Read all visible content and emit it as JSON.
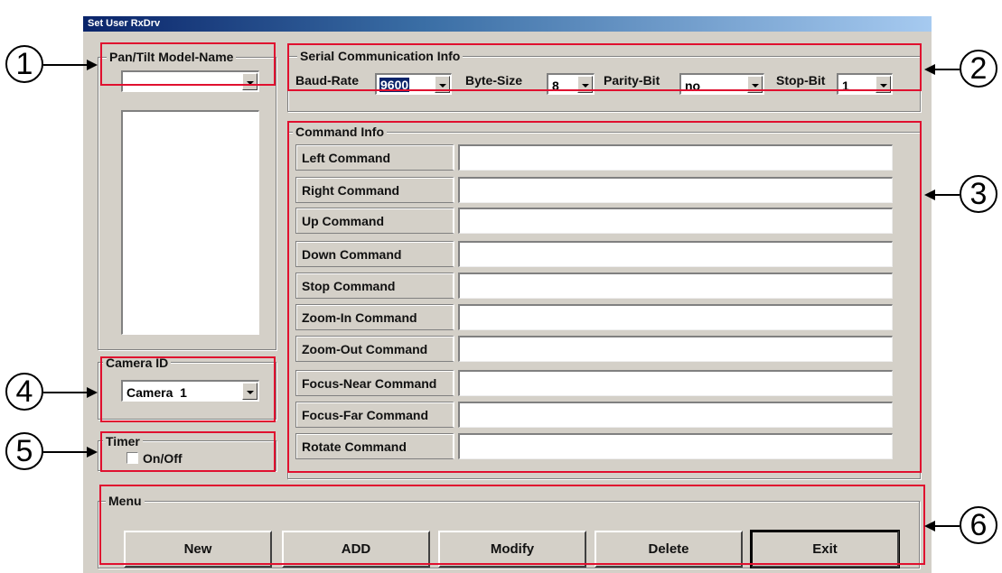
{
  "window": {
    "title": "Set User RxDrv"
  },
  "model_group": {
    "legend": "Pan/Tilt Model-Name",
    "selected": ""
  },
  "serial_group": {
    "legend": "Serial Communication Info",
    "baud_label": "Baud-Rate",
    "baud_value": "9600",
    "byte_label": "Byte-Size",
    "byte_value": "8",
    "parity_label": "Parity-Bit",
    "parity_value": "no",
    "stop_label": "Stop-Bit",
    "stop_value": "1"
  },
  "command_group": {
    "legend": "Command Info",
    "commands": [
      "Left Command",
      "Right Command",
      "Up Command",
      "Down Command",
      "Stop Command",
      "Zoom-In Command",
      "Zoom-Out Command",
      "Focus-Near Command",
      "Focus-Far Command",
      "Rotate Command"
    ]
  },
  "camera_group": {
    "legend": "Camera ID",
    "selected": "Camera  1"
  },
  "timer_group": {
    "legend": "Timer",
    "checkbox_label": "On/Off",
    "checked": false
  },
  "menu_group": {
    "legend": "Menu",
    "buttons": [
      "New",
      "ADD",
      "Modify",
      "Delete",
      "Exit"
    ]
  },
  "callouts": [
    "1",
    "2",
    "3",
    "4",
    "5",
    "6"
  ],
  "colors": {
    "highlight": "#e0102f",
    "titlebar": "#0a246a",
    "selection": "#0a246a"
  }
}
